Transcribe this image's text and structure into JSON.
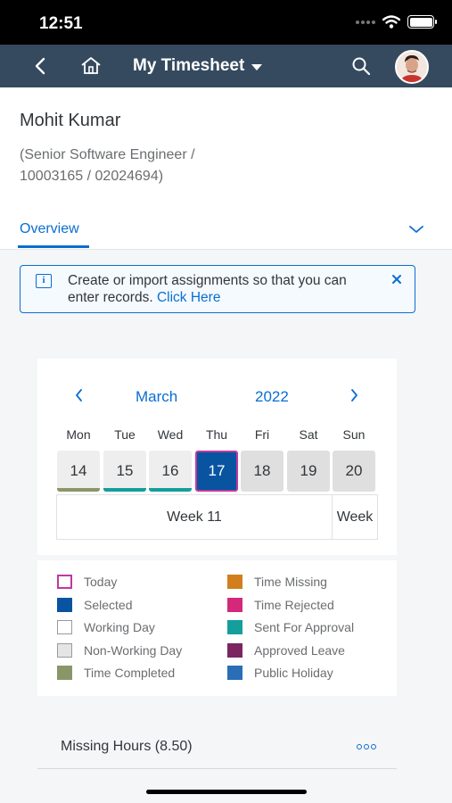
{
  "status_bar": {
    "time": "12:51"
  },
  "shell": {
    "title": "My Timesheet"
  },
  "employee": {
    "name": "Mohit Kumar",
    "details_line1": "(Senior Software Engineer /",
    "details_line2": "10003165 / 02024694)"
  },
  "tabs": {
    "overview_label": "Overview"
  },
  "info_strip": {
    "text": "Create or import assignments so that you can enter records.",
    "link": "Click Here",
    "icon": "i"
  },
  "calendar": {
    "month": "March",
    "year": "2022",
    "weekdays": [
      "Mon",
      "Tue",
      "Wed",
      "Thu",
      "Fri",
      "Sat",
      "Sun"
    ],
    "days": [
      {
        "num": "14",
        "status": "Time Completed",
        "status_color": "#8a9668"
      },
      {
        "num": "15",
        "status": "Sent For Approval",
        "status_color": "#149e9c"
      },
      {
        "num": "16",
        "status": "Sent For Approval",
        "status_color": "#149e9c"
      },
      {
        "num": "17",
        "status": "Selected",
        "status_color": "#0854a0"
      },
      {
        "num": "18",
        "status": "Non-Working Day",
        "status_color": "#dfdfdf"
      },
      {
        "num": "19",
        "status": "Non-Working Day",
        "status_color": "#dfdfdf"
      },
      {
        "num": "20",
        "status": "Non-Working Day",
        "status_color": "#dfdfdf"
      }
    ],
    "week_label": "Week 11",
    "week_label_next": "Week"
  },
  "legend": {
    "items": [
      {
        "label": "Today",
        "color": "#c0399f",
        "style": "outline"
      },
      {
        "label": "Selected",
        "color": "#0854a0",
        "style": "fill"
      },
      {
        "label": "Working Day",
        "color": "#ffffff",
        "style": "outline-grey"
      },
      {
        "label": "Non-Working Day",
        "color": "#e5e5e5",
        "style": "fill-grey"
      },
      {
        "label": "Time Completed",
        "color": "#8a9668",
        "style": "fill"
      },
      {
        "label": "Time Missing",
        "color": "#d27e1d",
        "style": "fill"
      },
      {
        "label": "Time Rejected",
        "color": "#d4297b",
        "style": "fill"
      },
      {
        "label": "Sent For Approval",
        "color": "#149e9c",
        "style": "fill"
      },
      {
        "label": "Approved Leave",
        "color": "#7b2561",
        "style": "fill"
      },
      {
        "label": "Public Holiday",
        "color": "#2a6eb5",
        "style": "fill"
      }
    ]
  },
  "missing_hours": {
    "label": "Missing Hours (8.50)"
  }
}
